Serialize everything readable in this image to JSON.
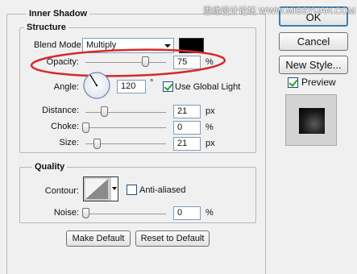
{
  "watermark": "思缘设计论坛 WWW.MISSYUAN.COM",
  "panel_title": "Inner Shadow",
  "structure": {
    "title": "Structure",
    "blend_mode_label": "Blend Mode:",
    "blend_mode_value": "Multiply",
    "shadow_color": "#000000",
    "opacity_label": "Opacity:",
    "opacity_value": "75",
    "opacity_unit": "%",
    "angle_label": "Angle:",
    "angle_value": "120",
    "angle_unit": "°",
    "use_global_light_label": "Use Global Light",
    "use_global_light_checked": true,
    "distance_label": "Distance:",
    "distance_value": "21",
    "distance_unit": "px",
    "choke_label": "Choke:",
    "choke_value": "0",
    "choke_unit": "%",
    "size_label": "Size:",
    "size_value": "21",
    "size_unit": "px"
  },
  "quality": {
    "title": "Quality",
    "contour_label": "Contour:",
    "anti_aliased_label": "Anti-aliased",
    "anti_aliased_checked": false,
    "noise_label": "Noise:",
    "noise_value": "0",
    "noise_unit": "%"
  },
  "buttons": {
    "make_default": "Make Default",
    "reset_to_default": "Reset to Default",
    "ok": "OK",
    "cancel": "Cancel",
    "new_style": "New Style..."
  },
  "preview": {
    "label": "Preview",
    "checked": true
  },
  "colors": {
    "annotation_ellipse": "#d42a2a",
    "ok_border": "#3c7fb1"
  }
}
